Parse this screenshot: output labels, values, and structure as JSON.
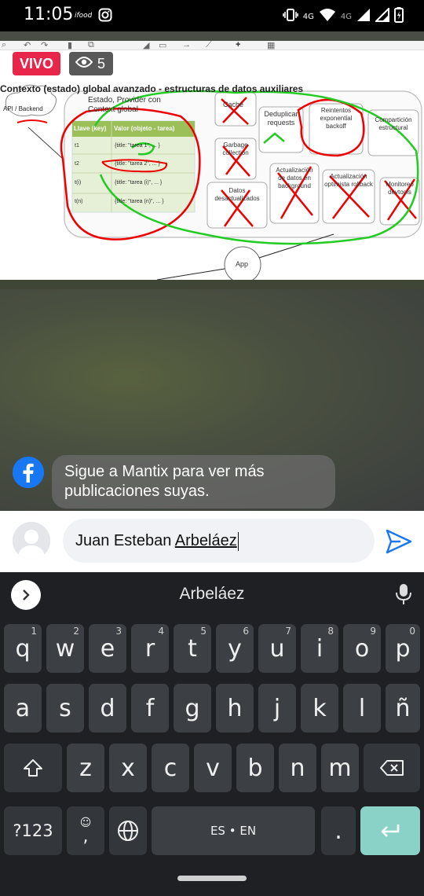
{
  "status_bar": {
    "time": "11:05",
    "network_label": "4G",
    "network_label2": "4G",
    "icons": [
      "notification-icon",
      "instagram-icon",
      "vibrate-icon",
      "signal-icon",
      "wifi-icon",
      "signal-icon",
      "signal-icon",
      "battery-charging-icon"
    ]
  },
  "live": {
    "badge_label": "VIVO",
    "viewer_count": "5",
    "badge_color": "#e8264a"
  },
  "slide": {
    "title": "Contexto (estado) global avanzado - estructuras de datos auxiliares",
    "api_label": "API / Backend",
    "provider_label": "Estado, Provider con Context global",
    "table_headers": [
      "Llave (key)",
      "Valor (objeto - tarea)"
    ],
    "table_rows": [
      [
        "t1",
        "{title: \"tarea 1\", ... }"
      ],
      [
        "t2",
        "{title: \"tarea 2\", ... }"
      ],
      [
        "t(i)",
        "{title: \"tarea (i)\", ... }"
      ],
      [
        "t(n)",
        "{title: \"tarea (n)\", ... }"
      ]
    ],
    "features": [
      "Caché",
      "Deduplicar requests",
      "Reintentos exponential backoff",
      "Compartición estructural",
      "Garbage collection",
      "Actualización de datos en background",
      "Actualización optimista rollback",
      "Monitoreo devtools",
      "Datos desactualizados"
    ],
    "app_label": "App"
  },
  "chat": {
    "message": "Sigue a Mantix para ver más publicaciones suyas."
  },
  "comment": {
    "text_before": "Juan Esteban ",
    "text_underlined": "Arbeláez"
  },
  "keyboard": {
    "suggestion": "Arbeláez",
    "row1": [
      [
        "q",
        "1"
      ],
      [
        "w",
        "2"
      ],
      [
        "e",
        "3"
      ],
      [
        "r",
        "4"
      ],
      [
        "t",
        "5"
      ],
      [
        "y",
        "6"
      ],
      [
        "u",
        "7"
      ],
      [
        "i",
        "8"
      ],
      [
        "o",
        "9"
      ],
      [
        "p",
        "0"
      ]
    ],
    "row2": [
      "a",
      "s",
      "d",
      "f",
      "g",
      "h",
      "j",
      "k",
      "l",
      "ñ"
    ],
    "row3": [
      "z",
      "x",
      "c",
      "v",
      "b",
      "n",
      "m"
    ],
    "symbols_label": "?123",
    "comma_label": ",",
    "space_label": "ES • EN",
    "period_label": ".",
    "accent_color": "#8ad2c8"
  }
}
